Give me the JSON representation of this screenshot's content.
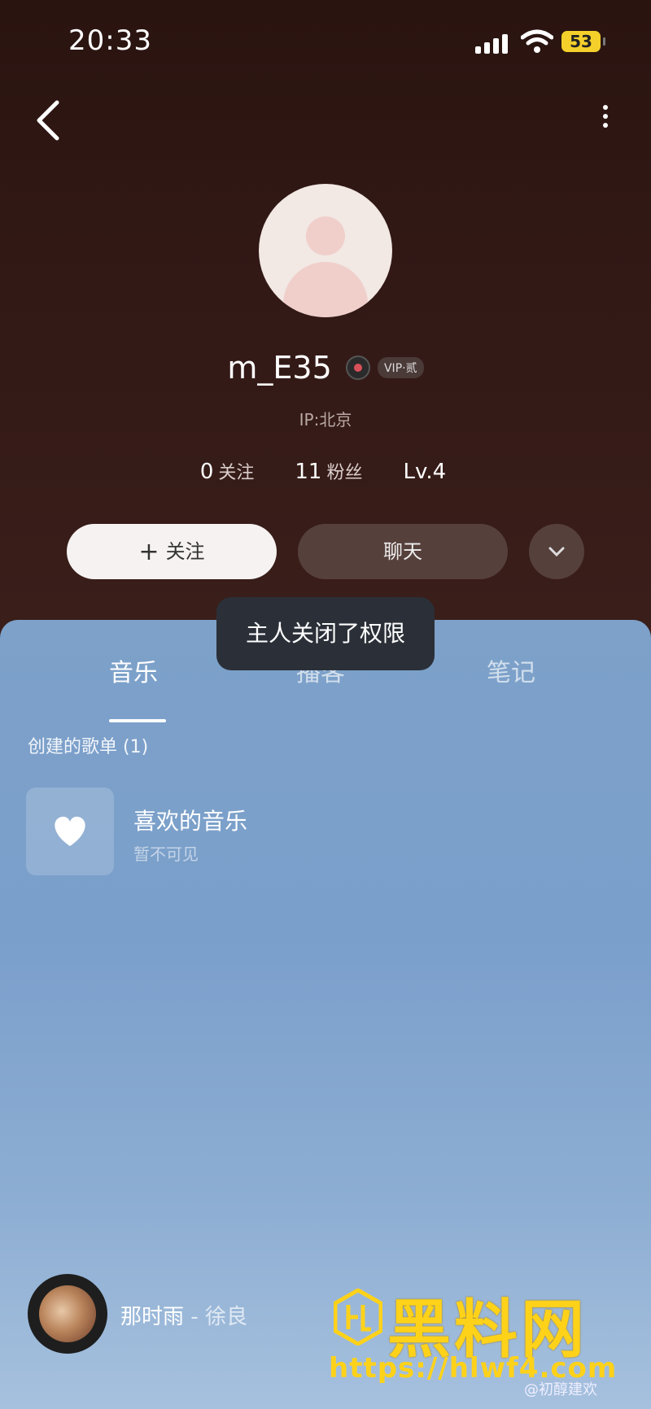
{
  "status_bar": {
    "time": "20:33",
    "battery": "53"
  },
  "profile": {
    "username": "m_E35",
    "vip_badge": "VIP·贰",
    "ip": "IP:北京",
    "following_count": "0",
    "following_label": "关注",
    "followers_count": "11",
    "followers_label": "粉丝",
    "level": "Lv.4"
  },
  "actions": {
    "follow_label": "关注",
    "follow_plus": "+",
    "chat_label": "聊天"
  },
  "tabs": [
    {
      "label": "音乐",
      "active": true
    },
    {
      "label": "播客",
      "active": false
    },
    {
      "label": "笔记",
      "active": false
    }
  ],
  "playlists_section": {
    "title": "创建的歌单 (1)"
  },
  "playlists": [
    {
      "title": "喜欢的音乐",
      "subtitle": "暂不可见"
    }
  ],
  "toast": "主人关闭了权限",
  "now_playing": {
    "song": "那时雨",
    "separator": " - ",
    "artist": "徐良"
  },
  "watermark": {
    "brand": "黑料网",
    "url": "https://hlwf4.com",
    "credit": "@初醇建欢"
  },
  "colors": {
    "accent_yellow": "#ffd21a",
    "header_bg": "#2b1512",
    "list_bg": "#7da1c9"
  }
}
